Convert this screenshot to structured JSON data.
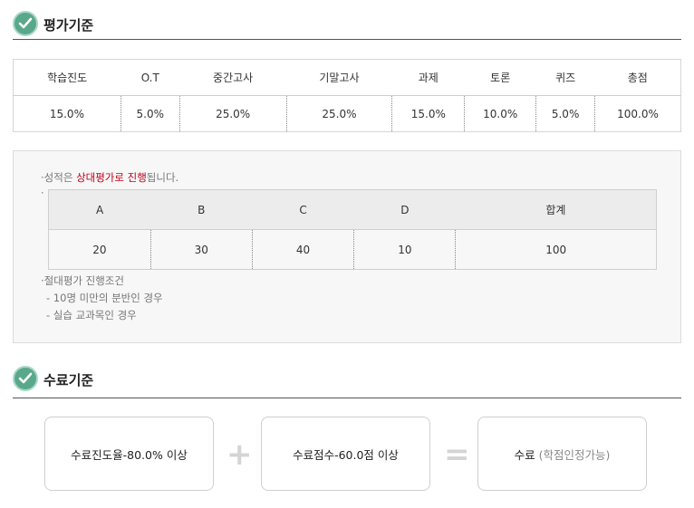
{
  "section1": {
    "title": "평가기준"
  },
  "evaluation": {
    "headers": [
      "학습진도",
      "O.T",
      "중간고사",
      "기말고사",
      "과제",
      "토론",
      "퀴즈",
      "총점"
    ],
    "values": [
      "15.0%",
      "5.0%",
      "25.0%",
      "25.0%",
      "15.0%",
      "10.0%",
      "5.0%",
      "100.0%"
    ]
  },
  "grading": {
    "note_prefix": "·성적은 ",
    "note_highlight": "상대평가로 진행",
    "note_suffix": "됩니다.",
    "bullet": "·",
    "headers": [
      "A",
      "B",
      "C",
      "D",
      "합계"
    ],
    "values": [
      "20",
      "30",
      "40",
      "10",
      "100"
    ],
    "absolute_title": "·절대평가 진행조건",
    "conditions": [
      "- 10명 미만의 분반인 경우",
      "- 실습 교과목인 경우"
    ]
  },
  "section2": {
    "title": "수료기준"
  },
  "completion": {
    "box1": "수료진도율-80.0% 이상",
    "plus": "+",
    "box2": "수료점수-60.0점 이상",
    "equals": "=",
    "box3_main": "수료",
    "box3_sub": "(학점인정가능)"
  },
  "colors": {
    "check_icon": "#5aa88c",
    "highlight": "#c0001a"
  }
}
